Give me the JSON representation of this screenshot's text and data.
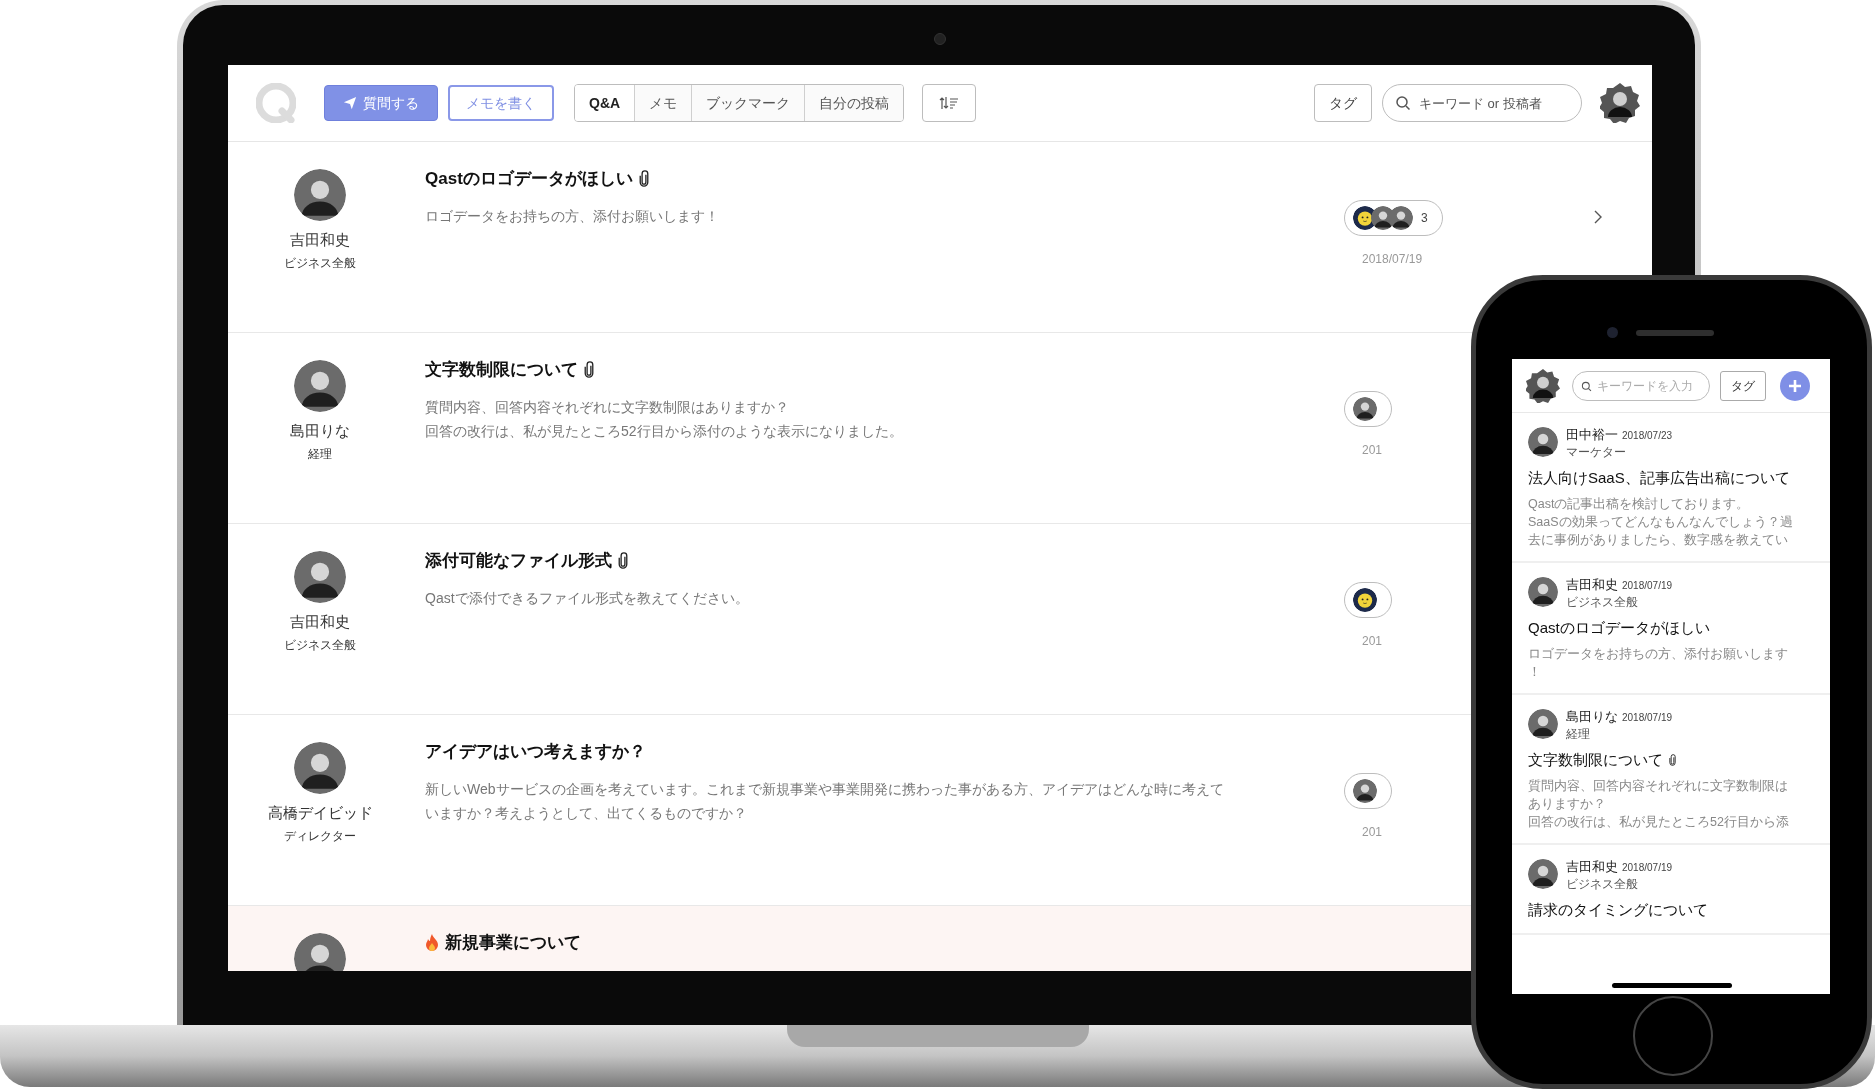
{
  "laptop": {
    "header": {
      "primary_button": "質問する",
      "secondary_button": "メモを書く",
      "tabs": [
        {
          "label": "Q&A",
          "selected": true
        },
        {
          "label": "メモ",
          "selected": false
        },
        {
          "label": "ブックマーク",
          "selected": false
        },
        {
          "label": "自分の投稿",
          "selected": false
        }
      ],
      "tag_button": "タグ",
      "search": {
        "placeholder": "キーワード or 投稿者"
      }
    },
    "posts": [
      {
        "author": "吉田和史",
        "role": "ビジネス全般",
        "title": "Qastのロゴデータがほしい",
        "attachment": true,
        "hot": false,
        "body": [
          "ロゴデータをお持ちの方、添付お願いします！"
        ],
        "avatars": [
          {
            "kind": "mascot"
          },
          {
            "kind": "person"
          },
          {
            "kind": "person"
          }
        ],
        "count": "3",
        "date": "2018/07/19"
      },
      {
        "author": "島田りな",
        "role": "経理",
        "title": "文字数制限について",
        "attachment": true,
        "hot": false,
        "body": [
          "質問内容、回答内容それぞれに文字数制限はありますか？",
          "回答の改行は、私が見たところ52行目から添付のような表示になりました。"
        ],
        "avatars": [
          {
            "kind": "person"
          }
        ],
        "date": "201"
      },
      {
        "author": "吉田和史",
        "role": "ビジネス全般",
        "title": "添付可能なファイル形式",
        "attachment": true,
        "hot": false,
        "body": [
          "Qastで添付できるファイル形式を教えてください。"
        ],
        "avatars": [
          {
            "kind": "mascot"
          }
        ],
        "date": "201"
      },
      {
        "author": "高橋デイビッド",
        "role": "ディレクター",
        "title": "アイデアはいつ考えますか？",
        "attachment": false,
        "hot": false,
        "body": [
          "新しいWebサービスの企画を考えています。これまで新規事業や事業開発に携わった事がある方、アイデアはどんな時に考えて",
          "いますか？考えようとして、出てくるものですか？"
        ],
        "avatars": [
          {
            "kind": "person"
          }
        ],
        "date": "201"
      },
      {
        "title": "新規事業について",
        "attachment": false,
        "hot": true
      }
    ]
  },
  "phone": {
    "search": {
      "placeholder": "キーワードを入力"
    },
    "tag_button": "タグ",
    "posts": [
      {
        "author": "田中裕一",
        "date": "2018/07/23",
        "role": "マーケター",
        "title": "法人向けSaaS、記事広告出稿について",
        "attachment": false,
        "body": [
          "Qastの記事出稿を検討しております。",
          "SaaSの効果ってどんなもんなんでしょう？過",
          "去に事例がありましたら、数字感を教えてい"
        ]
      },
      {
        "author": "吉田和史",
        "date": "2018/07/19",
        "role": "ビジネス全般",
        "title": "Qastのロゴデータがほしい",
        "attachment": false,
        "body": [
          "ロゴデータをお持ちの方、添付お願いします",
          "！"
        ]
      },
      {
        "author": "島田りな",
        "date": "2018/07/19",
        "role": "経理",
        "title": "文字数制限について",
        "attachment": true,
        "body": [
          "質問内容、回答内容それぞれに文字数制限は",
          "ありますか？",
          "回答の改行は、私が見たところ52行目から添"
        ]
      },
      {
        "author": "吉田和史",
        "date": "2018/07/19",
        "role": "ビジネス全般",
        "title": "請求のタイミングについて",
        "attachment": false
      }
    ]
  }
}
